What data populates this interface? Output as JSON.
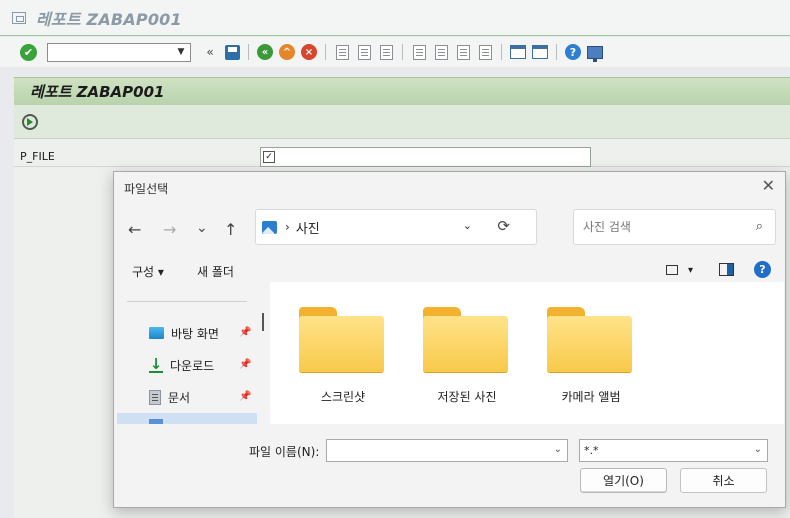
{
  "sap": {
    "window_title": "레포트 ZABAP001",
    "command_field_value": "",
    "report_title": "레포트 ZABAP001",
    "param_label": "P_FILE",
    "param_value": ""
  },
  "toolbar": {
    "back_label": "«",
    "ok_glyph": "✔",
    "dropdown_glyph": "▼"
  },
  "dialog": {
    "title": "파일선택",
    "close_glyph": "✕",
    "nav": {
      "back": "←",
      "forward": "→",
      "recent": "⌄",
      "up": "↑"
    },
    "address": {
      "separator": "›",
      "path": "사진",
      "dropdown": "⌄",
      "refresh": "⟳"
    },
    "search": {
      "placeholder": "사진 검색",
      "glyph": "⌕"
    },
    "commandbar": {
      "organize": "구성 ▾",
      "new_folder": "새 폴더",
      "view_dropdown": "▾",
      "help": "?"
    },
    "nav_items": [
      {
        "label": "바탕 화면",
        "icon": "desktop-icon"
      },
      {
        "label": "다운로드",
        "icon": "download-icon"
      },
      {
        "label": "문서",
        "icon": "documents-icon"
      }
    ],
    "pin_glyph": "📌",
    "folders": [
      "스크린샷",
      "저장된 사진",
      "카메라 앨범"
    ],
    "filename_label": "파일 이름(N):",
    "filename_value": "",
    "filter_value": "*.*",
    "combo_dropdown": "⌄",
    "open_label": "열기(O)",
    "cancel_label": "취소"
  }
}
